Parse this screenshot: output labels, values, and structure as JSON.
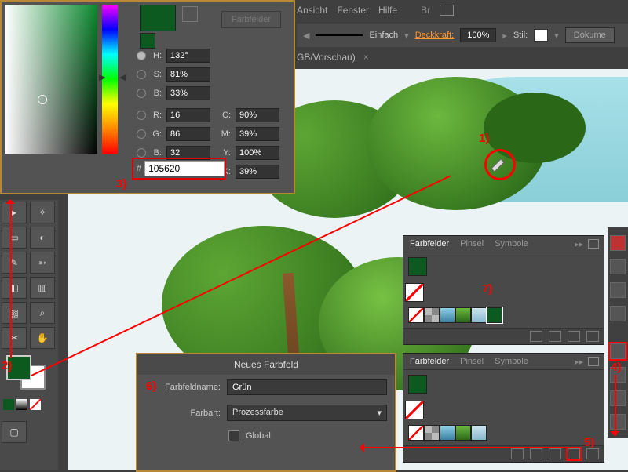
{
  "menu": {
    "ansicht": "Ansicht",
    "fenster": "Fenster",
    "hilfe": "Hilfe"
  },
  "topbar": {
    "strokeStyle": "Einfach",
    "opacityLabel": "Deckkraft:",
    "opacity": "100%",
    "stilLabel": "Stil:",
    "docBtn": "Dokume"
  },
  "tab": {
    "label": "GB/Vorschau)",
    "close": "×"
  },
  "colorpanel": {
    "farbfelder": "Farbfelder",
    "H": {
      "l": "H:",
      "v": "132°"
    },
    "S": {
      "l": "S:",
      "v": "81%"
    },
    "Bv": {
      "l": "B:",
      "v": "33%"
    },
    "R": {
      "l": "R:",
      "v": "16"
    },
    "G": {
      "l": "G:",
      "v": "86"
    },
    "Bb": {
      "l": "B:",
      "v": "32"
    },
    "C": {
      "l": "C:",
      "v": "90%"
    },
    "M": {
      "l": "M:",
      "v": "39%"
    },
    "Y": {
      "l": "Y:",
      "v": "100%"
    },
    "K": {
      "l": "K:",
      "v": "39%"
    },
    "hash": "#",
    "hex": "105620"
  },
  "swatches": {
    "tabs": {
      "a": "Farbfelder",
      "b": "Pinsel",
      "c": "Symbole"
    }
  },
  "dialog": {
    "title": "Neues Farbfeld",
    "nameLabel": "Farbfeldname:",
    "nameVal": "Grün",
    "typeLabel": "Farbart:",
    "typeVal": "Prozessfarbe",
    "global": "Global"
  },
  "ann": {
    "n1": "1)",
    "n2": "2)",
    "n3": "3)",
    "n4": "4)",
    "n5": "5)",
    "n6": "6)",
    "n7": "7)"
  }
}
